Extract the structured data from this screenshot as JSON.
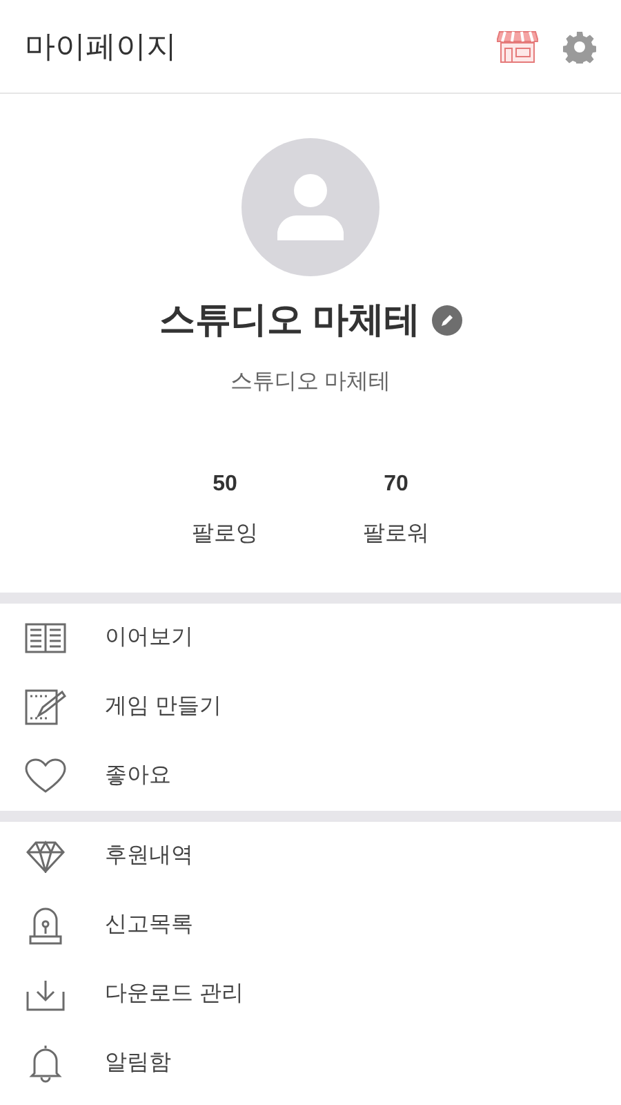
{
  "header": {
    "title": "마이페이지"
  },
  "profile": {
    "name": "스튜디오 마체테",
    "subtitle": "스튜디오 마체테"
  },
  "stats": [
    {
      "value": "50",
      "label": "팔로잉"
    },
    {
      "value": "70",
      "label": "팔로워"
    }
  ],
  "menu_groups": [
    {
      "items": [
        {
          "label": "이어보기"
        },
        {
          "label": "게임 만들기"
        },
        {
          "label": "좋아요"
        }
      ]
    },
    {
      "items": [
        {
          "label": "후원내역"
        },
        {
          "label": "신고목록"
        },
        {
          "label": "다운로드 관리"
        },
        {
          "label": "알림함"
        }
      ]
    }
  ]
}
